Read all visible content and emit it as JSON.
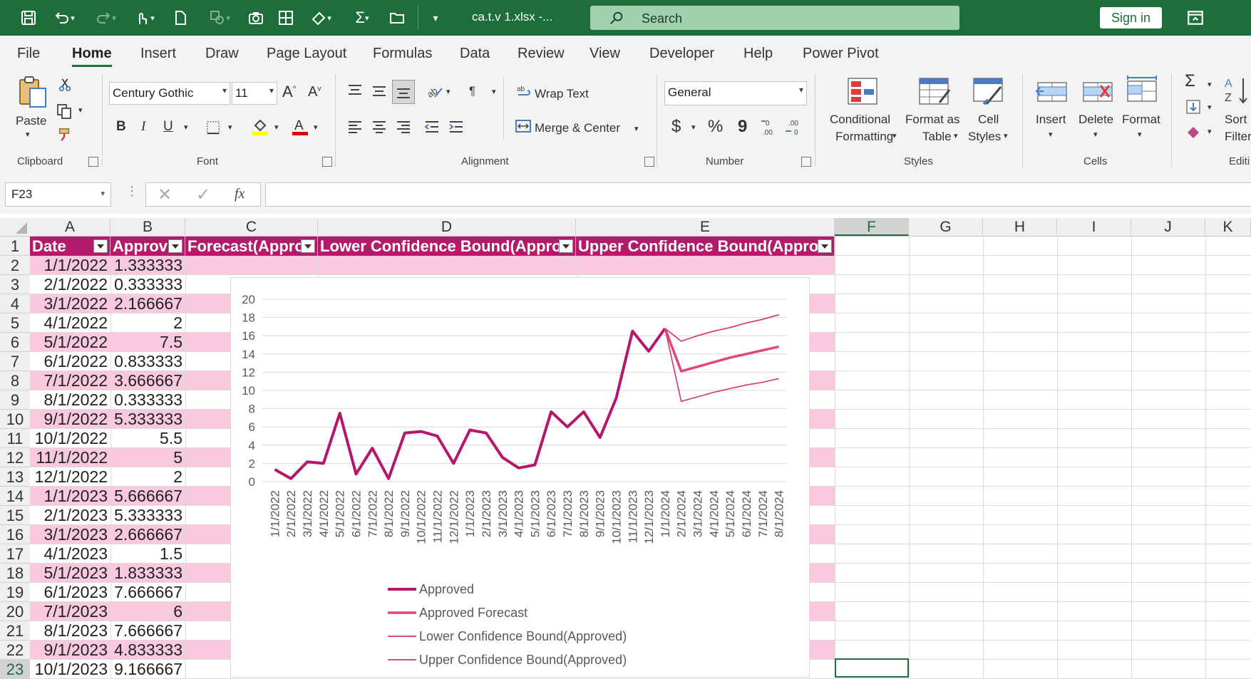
{
  "titlebar": {
    "filename": "ca.t.v 1.xlsx  -...",
    "search_placeholder": "Search",
    "signin_label": "Sign in"
  },
  "tabs": [
    "File",
    "Home",
    "Insert",
    "Draw",
    "Page Layout",
    "Formulas",
    "Data",
    "Review",
    "View",
    "Developer",
    "Help",
    "Power Pivot"
  ],
  "ribbon": {
    "clipboard": {
      "label": "Clipboard",
      "paste": "Paste"
    },
    "font": {
      "label": "Font",
      "family": "Century Gothic",
      "size": "11",
      "bold": "B",
      "italic": "I",
      "underline": "U"
    },
    "alignment": {
      "label": "Alignment",
      "wrap": "Wrap Text",
      "merge": "Merge & Center"
    },
    "number": {
      "label": "Number",
      "format": "General",
      "currency": "$",
      "percent": "%",
      "comma": "9"
    },
    "styles": {
      "label": "Styles",
      "cond1": "Conditional",
      "cond2": "Formatting",
      "fmt1": "Format as",
      "fmt2": "Table",
      "cell1": "Cell",
      "cell2": "Styles"
    },
    "cells": {
      "label": "Cells",
      "insert": "Insert",
      "delete": "Delete",
      "format": "Format"
    },
    "editing": {
      "label": "Editi",
      "sort1": "Sort",
      "sort2": "Filter"
    }
  },
  "formula_bar": {
    "name_box": "F23",
    "fx": "fx",
    "value": ""
  },
  "sheet": {
    "columns": [
      "A",
      "B",
      "C",
      "D",
      "E",
      "F",
      "G",
      "H",
      "I",
      "J",
      "K"
    ],
    "selected_column": "F",
    "selected_row": "23",
    "header_row": [
      "Date",
      "Approv",
      "Forecast(Appro",
      "Lower Confidence Bound(Appro",
      "Upper Confidence Bound(Appro"
    ],
    "rows": [
      {
        "n": "1"
      },
      {
        "n": "2",
        "date": "1/1/2022",
        "value": "1.333333"
      },
      {
        "n": "3",
        "date": "2/1/2022",
        "value": "0.333333"
      },
      {
        "n": "4",
        "date": "3/1/2022",
        "value": "2.166667"
      },
      {
        "n": "5",
        "date": "4/1/2022",
        "value": "2"
      },
      {
        "n": "6",
        "date": "5/1/2022",
        "value": "7.5"
      },
      {
        "n": "7",
        "date": "6/1/2022",
        "value": "0.833333"
      },
      {
        "n": "8",
        "date": "7/1/2022",
        "value": "3.666667"
      },
      {
        "n": "9",
        "date": "8/1/2022",
        "value": "0.333333"
      },
      {
        "n": "10",
        "date": "9/1/2022",
        "value": "5.333333"
      },
      {
        "n": "11",
        "date": "10/1/2022",
        "value": "5.5"
      },
      {
        "n": "12",
        "date": "11/1/2022",
        "value": "5"
      },
      {
        "n": "13",
        "date": "12/1/2022",
        "value": "2"
      },
      {
        "n": "14",
        "date": "1/1/2023",
        "value": "5.666667"
      },
      {
        "n": "15",
        "date": "2/1/2023",
        "value": "5.333333"
      },
      {
        "n": "16",
        "date": "3/1/2023",
        "value": "2.666667"
      },
      {
        "n": "17",
        "date": "4/1/2023",
        "value": "1.5"
      },
      {
        "n": "18",
        "date": "5/1/2023",
        "value": "1.833333"
      },
      {
        "n": "19",
        "date": "6/1/2023",
        "value": "7.666667"
      },
      {
        "n": "20",
        "date": "7/1/2023",
        "value": "6"
      },
      {
        "n": "21",
        "date": "8/1/2023",
        "value": "7.666667"
      },
      {
        "n": "22",
        "date": "9/1/2023",
        "value": "4.833333"
      },
      {
        "n": "23",
        "date": "10/1/2023",
        "value": "9.166667"
      }
    ]
  },
  "colors": {
    "accent": "#1e6e3c",
    "table_header": "#b31a6a",
    "band": "#f8c8dc",
    "approved": "#b5176a",
    "forecast": "#e0457f",
    "bounds": "#d6336f"
  },
  "chart_data": {
    "type": "line",
    "x": [
      "1/1/2022",
      "2/1/2022",
      "3/1/2022",
      "4/1/2022",
      "5/1/2022",
      "6/1/2022",
      "7/1/2022",
      "8/1/2022",
      "9/1/2022",
      "10/1/2022",
      "11/1/2022",
      "12/1/2022",
      "1/1/2023",
      "2/1/2023",
      "3/1/2023",
      "4/1/2023",
      "5/1/2023",
      "6/1/2023",
      "7/1/2023",
      "8/1/2023",
      "9/1/2023",
      "10/1/2023",
      "11/1/2023",
      "12/1/2023",
      "1/1/2024",
      "2/1/2024",
      "3/1/2024",
      "4/1/2024",
      "5/1/2024",
      "6/1/2024",
      "7/1/2024",
      "8/1/2024"
    ],
    "ylim": [
      0,
      20
    ],
    "yticks": [
      0,
      2,
      4,
      6,
      8,
      10,
      12,
      14,
      16,
      18,
      20
    ],
    "grid": true,
    "legend": "bottom",
    "series": [
      {
        "name": "Approved",
        "values": [
          1.333333,
          0.333333,
          2.166667,
          2,
          7.5,
          0.833333,
          3.666667,
          0.333333,
          5.333333,
          5.5,
          5,
          2,
          5.666667,
          5.333333,
          2.666667,
          1.5,
          1.833333,
          7.666667,
          6,
          7.666667,
          4.833333,
          9.166667,
          16.5,
          14.3,
          16.8,
          null,
          null,
          null,
          null,
          null,
          null,
          null
        ]
      },
      {
        "name": "Approved Forecast",
        "values": [
          null,
          null,
          null,
          null,
          null,
          null,
          null,
          null,
          null,
          null,
          null,
          null,
          null,
          null,
          null,
          null,
          null,
          null,
          null,
          null,
          null,
          null,
          null,
          null,
          16.8,
          12.1,
          12.6,
          13.1,
          13.6,
          14.0,
          14.4,
          14.8
        ]
      },
      {
        "name": "Lower Confidence Bound(Approved)",
        "values": [
          null,
          null,
          null,
          null,
          null,
          null,
          null,
          null,
          null,
          null,
          null,
          null,
          null,
          null,
          null,
          null,
          null,
          null,
          null,
          null,
          null,
          null,
          null,
          null,
          16.8,
          8.8,
          9.3,
          9.8,
          10.2,
          10.6,
          10.9,
          11.3
        ]
      },
      {
        "name": "Upper Confidence Bound(Approved)",
        "values": [
          null,
          null,
          null,
          null,
          null,
          null,
          null,
          null,
          null,
          null,
          null,
          null,
          null,
          null,
          null,
          null,
          null,
          null,
          null,
          null,
          null,
          null,
          null,
          null,
          16.8,
          15.4,
          16.0,
          16.5,
          16.9,
          17.4,
          17.8,
          18.3
        ]
      }
    ]
  }
}
